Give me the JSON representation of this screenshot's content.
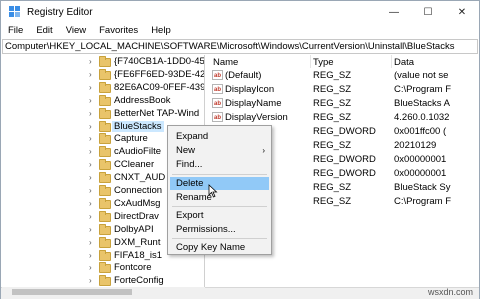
{
  "window": {
    "title": "Registry Editor",
    "controls": {
      "minimize": "—",
      "maximize": "☐",
      "close": "✕"
    }
  },
  "menu": [
    "File",
    "Edit",
    "View",
    "Favorites",
    "Help"
  ],
  "address": "Computer\\HKEY_LOCAL_MACHINE\\SOFTWARE\\Microsoft\\Windows\\CurrentVersion\\Uninstall\\BlueStacks",
  "tree": {
    "items": [
      {
        "label": "{F740CB1A-1DD0-45"
      },
      {
        "label": "{FE6FF6ED-93DE-42"
      },
      {
        "label": "82E6AC09-0FEF-4390"
      },
      {
        "label": "AddressBook"
      },
      {
        "label": "BetterNet TAP-Wind"
      },
      {
        "label": "BlueStacks"
      },
      {
        "label": "Capture"
      },
      {
        "label": "cAudioFilte"
      },
      {
        "label": "CCleaner"
      },
      {
        "label": "CNXT_AUD"
      },
      {
        "label": "Connection"
      },
      {
        "label": "CxAudMsg"
      },
      {
        "label": "DirectDrav"
      },
      {
        "label": "DolbyAPI"
      },
      {
        "label": "DXM_Runt"
      },
      {
        "label": "FIFA18_is1"
      },
      {
        "label": "Fontcore"
      },
      {
        "label": "ForteConfig"
      }
    ],
    "selected_index": 5
  },
  "columns": {
    "name": "Name",
    "type": "Type",
    "data": "Data"
  },
  "values": [
    {
      "name": "(Default)",
      "type": "REG_SZ",
      "data": "(value not se",
      "icon": "sz"
    },
    {
      "name": "DisplayIcon",
      "type": "REG_SZ",
      "data": "C:\\Program F",
      "icon": "sz"
    },
    {
      "name": "DisplayName",
      "type": "REG_SZ",
      "data": "BlueStacks A",
      "icon": "sz"
    },
    {
      "name": "DisplayVersion",
      "type": "REG_SZ",
      "data": "4.260.0.1032",
      "icon": "sz"
    },
    {
      "name": "ze",
      "type": "REG_DWORD",
      "data": "0x001ffc00 (",
      "icon": "bin"
    },
    {
      "name": "",
      "type": "REG_SZ",
      "data": "20210129",
      "icon": "sz"
    },
    {
      "name": "",
      "type": "REG_DWORD",
      "data": "0x00000001",
      "icon": "bin"
    },
    {
      "name": "",
      "type": "REG_DWORD",
      "data": "0x00000001",
      "icon": "bin"
    },
    {
      "name": "",
      "type": "REG_SZ",
      "data": "BlueStack Sy",
      "icon": "sz"
    },
    {
      "name": "ng",
      "type": "REG_SZ",
      "data": "C:\\Program F",
      "icon": "sz"
    }
  ],
  "context_menu": {
    "items": [
      "Expand",
      "New",
      "Find...",
      "Delete",
      "Rename",
      "Export",
      "Permissions...",
      "Copy Key Name"
    ],
    "highlighted": "Delete",
    "submenu_arrow": "›"
  },
  "watermark": "wsxdn.com",
  "icons": {
    "sz_glyph": "ab",
    "bin_glyph": "011"
  },
  "colors": {
    "highlight": "#91c9f7",
    "selection": "#cce8ff"
  }
}
